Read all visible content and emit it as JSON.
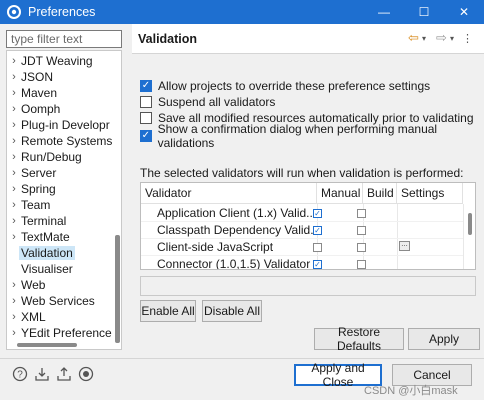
{
  "window": {
    "title": "Preferences",
    "controls": {
      "minimize": "—",
      "maximize": "☐",
      "close": "✕"
    }
  },
  "filter": {
    "placeholder": "type filter text"
  },
  "tree": {
    "items": [
      {
        "label": "JDT Weaving",
        "chevron": "›",
        "selected": false
      },
      {
        "label": "JSON",
        "chevron": "›",
        "selected": false
      },
      {
        "label": "Maven",
        "chevron": "›",
        "selected": false
      },
      {
        "label": "Oomph",
        "chevron": "›",
        "selected": false
      },
      {
        "label": "Plug-in Developr",
        "chevron": "›",
        "selected": false
      },
      {
        "label": "Remote Systems",
        "chevron": "›",
        "selected": false
      },
      {
        "label": "Run/Debug",
        "chevron": "›",
        "selected": false
      },
      {
        "label": "Server",
        "chevron": "›",
        "selected": false
      },
      {
        "label": "Spring",
        "chevron": "›",
        "selected": false
      },
      {
        "label": "Team",
        "chevron": "›",
        "selected": false
      },
      {
        "label": "Terminal",
        "chevron": "›",
        "selected": false
      },
      {
        "label": "TextMate",
        "chevron": "›",
        "selected": false
      },
      {
        "label": "Validation",
        "chevron": "",
        "selected": true
      },
      {
        "label": "Visualiser",
        "chevron": "",
        "selected": false
      },
      {
        "label": "Web",
        "chevron": "›",
        "selected": false
      },
      {
        "label": "Web Services",
        "chevron": "›",
        "selected": false
      },
      {
        "label": "XML",
        "chevron": "›",
        "selected": false
      },
      {
        "label": "YEdit Preference",
        "chevron": "›",
        "selected": false
      }
    ]
  },
  "page": {
    "title": "Validation",
    "nav": {
      "back": "⇦",
      "forward": "⇨",
      "dropdown": "▾",
      "menu": "⋮"
    }
  },
  "options": [
    {
      "label": "Allow projects to override these preference settings",
      "checked": true
    },
    {
      "label": "Suspend all validators",
      "checked": false
    },
    {
      "label": "Save all modified resources automatically prior to validating",
      "checked": false
    },
    {
      "label": "Show a confirmation dialog when performing manual validations",
      "checked": true
    }
  ],
  "validators": {
    "info": "The selected validators will run when validation is performed:",
    "columns": {
      "validator": "Validator",
      "manual": "Manual",
      "build": "Build",
      "settings": "Settings"
    },
    "rows": [
      {
        "name": "Application Client (1.x) Valid...",
        "manual": true,
        "build": false,
        "settings": false
      },
      {
        "name": "Classpath Dependency Valid...",
        "manual": true,
        "build": false,
        "settings": false
      },
      {
        "name": "Client-side JavaScript",
        "manual": false,
        "build": false,
        "settings": true
      },
      {
        "name": "Connector (1.0,1.5) Validator",
        "manual": true,
        "build": false,
        "settings": false
      }
    ],
    "settings_glyph": "…"
  },
  "buttons": {
    "enable_all": "Enable All",
    "disable_all": "Disable All",
    "restore_defaults": "Restore Defaults",
    "apply": "Apply",
    "apply_and_close": "Apply and Close",
    "cancel": "Cancel"
  },
  "bottom_icons": {
    "help": "?",
    "import": "⇩",
    "export": "⇧",
    "record": "◉"
  },
  "watermark": "CSDN @小白mask",
  "colors": {
    "accent": "#1e6fd0",
    "selection": "#cde6f7"
  }
}
